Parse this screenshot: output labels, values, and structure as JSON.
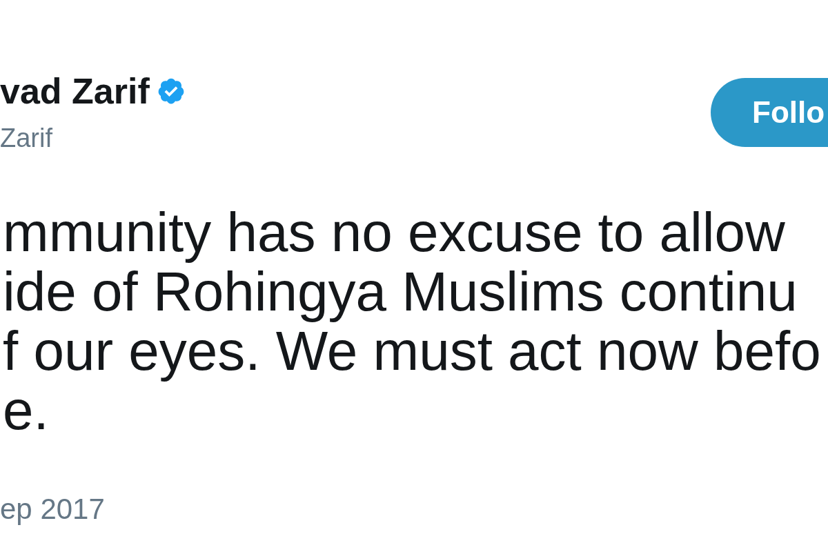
{
  "author": {
    "name": "vad Zarif",
    "verified": true,
    "handle": "Zarif"
  },
  "follow_button": {
    "label": "Follo"
  },
  "tweet": {
    "lines": [
      "mmunity has no excuse to allow",
      "ide of Rohingya Muslims continu",
      "f our eyes. We must act now befo",
      "e."
    ]
  },
  "date": "ep 2017"
}
